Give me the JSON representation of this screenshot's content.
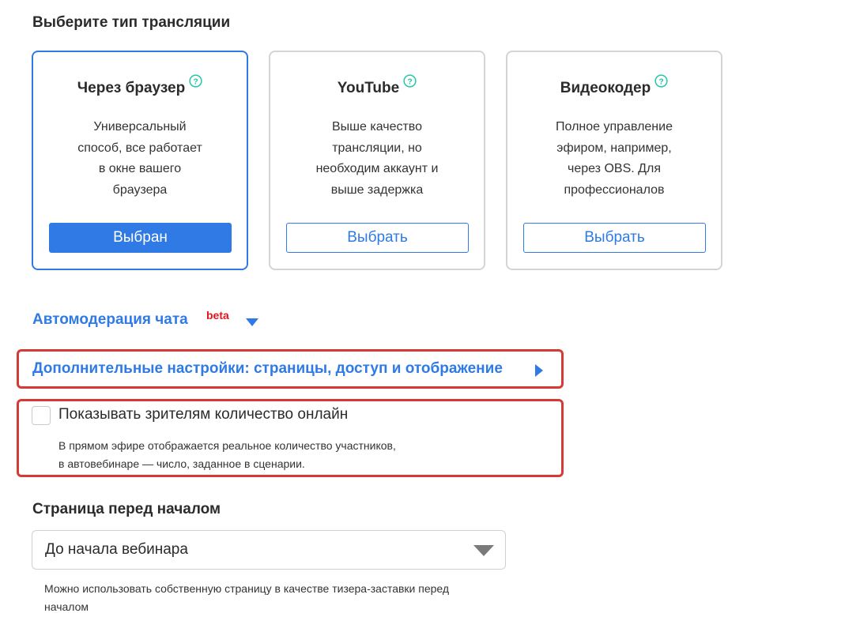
{
  "section_title": "Выберите тип трансляции",
  "cards": [
    {
      "title": "Через браузер",
      "description": [
        "Универсальный",
        "способ, все работает",
        "в окне вашего",
        "браузера"
      ],
      "button_label": "Выбран",
      "selected": true
    },
    {
      "title": "YouTube",
      "description": [
        "Выше качество",
        "трансляции, но",
        "необходим аккаунт и",
        "выше задержка"
      ],
      "button_label": "Выбрать",
      "selected": false
    },
    {
      "title": "Видеокодер",
      "description": [
        "Полное управление",
        "эфиром, например,",
        "через OBS. Для",
        "профессионалов"
      ],
      "button_label": "Выбрать",
      "selected": false
    }
  ],
  "automoderation": {
    "label": "Автомодерация чата",
    "badge": "beta"
  },
  "advanced_settings": {
    "label": "Дополнительные настройки: страницы, доступ и отображение"
  },
  "show_online_count": {
    "label": "Показывать зрителям количество онлайн",
    "checked": false,
    "hint": [
      "В прямом эфире отображается реальное количество участников,",
      "в автовебинаре — число, заданное в сценарии."
    ]
  },
  "page_before_start": {
    "title": "Страница перед началом",
    "selected_value": "До начала вебинара",
    "hint": [
      "Можно использовать собственную страницу в качестве тизера-заставки перед",
      "началом"
    ]
  },
  "colors": {
    "accent": "#2f7ae5",
    "highlight": "#d63a36",
    "beta": "#e3141c",
    "help_icon": "#26c7a9"
  },
  "icons": {
    "help": "question-circle-icon",
    "automod_toggle": "caret-down-icon",
    "advanced_toggle": "caret-right-icon",
    "select_toggle": "caret-down-icon"
  }
}
